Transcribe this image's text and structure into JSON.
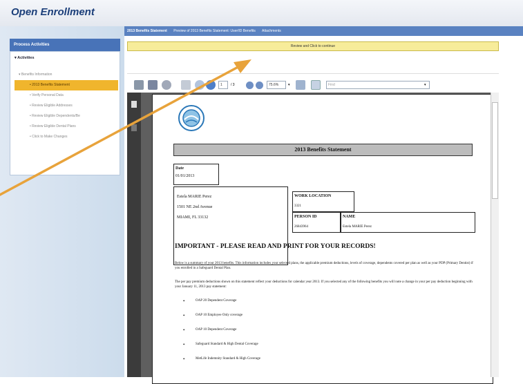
{
  "app": {
    "title": "Open Enrollment"
  },
  "sidebar": {
    "header": "Process Activities",
    "section": "Activities",
    "items": [
      {
        "label": "Benefits Information"
      },
      {
        "label": "2013 Benefits Statement"
      },
      {
        "label": "Verify Personal Data"
      },
      {
        "label": "Review Eligible Addresses"
      },
      {
        "label": "Review Eligible Dependents/Be"
      },
      {
        "label": "Review Eligible Dental Plans"
      },
      {
        "label": "Click to Make Changes"
      }
    ]
  },
  "topbar": {
    "tab_active": "2013 Benefits Statement",
    "tab_preview": "Preview of 2013 Benefits Statement: User/ID Benefits",
    "attachments": "Attachments"
  },
  "review_bar": {
    "label": "Review and Click to continue"
  },
  "toolbar": {
    "page": "1",
    "page_total": "/ 3",
    "zoom": "75.6%",
    "find_placeholder": "Find"
  },
  "document": {
    "statement_title": "2013  Benefits Statement",
    "date_label": "Date",
    "date_value": "01/01/2013",
    "address_name": "Estela MARIE Perez",
    "address_line1": "1501 NE 2nd Avenue",
    "address_line2": "MIAMI, FL 33132",
    "work_location_label": "WORK LOCATION",
    "work_location_value": "3321",
    "person_id_label": "PERSON ID",
    "person_id_value": "26843964",
    "name_label": "NAME",
    "name_value": "Estela MARIE Perez",
    "important": "IMPORTANT  - PLEASE READ AND PRINT FOR YOUR RECORDS!",
    "para1": "Below is a summary of your 2013 benefits.  This information includes your selected plans, the applicable premium deductions, levels of coverage, dependents covered per plan as well as your PDP (Primary Dentist) if you enrolled in a Safeguard Dental Plan.",
    "para2": "The per pay premium deductions shown on this statement reflect your deductions for calendar year 2013.  If you selected any of the following benefits you will note a change in your per pay deduction beginning with your January 11, 2013 pay statement:",
    "bullets": [
      "OAP 20 Dependent Coverage",
      "OAP 10 Employee Only coverage",
      "OAP 10 Dependent Coverage",
      "Safeguard Standard & High Dental Coverage",
      "MetLife Indemnity Standard & High Coverage"
    ]
  },
  "colors": {
    "accent": "#e8a33b",
    "header_blue": "#4873b8",
    "selected": "#f0b52d"
  }
}
